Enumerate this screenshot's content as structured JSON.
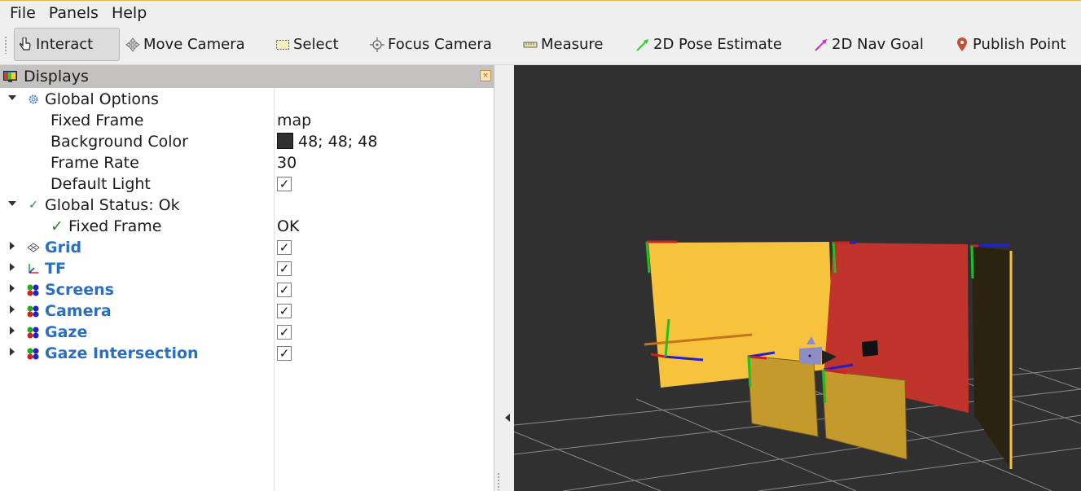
{
  "menu": {
    "file": "File",
    "panels": "Panels",
    "help": "Help"
  },
  "toolbar": {
    "tools": [
      {
        "label": "Interact",
        "icon": "hand-pointer-icon"
      },
      {
        "label": "Move Camera",
        "icon": "move-camera-icon"
      },
      {
        "label": "Select",
        "icon": "select-rect-icon"
      },
      {
        "label": "Focus Camera",
        "icon": "focus-camera-icon"
      },
      {
        "label": "Measure",
        "icon": "ruler-icon"
      },
      {
        "label": "2D Pose Estimate",
        "icon": "green-arrow-icon"
      },
      {
        "label": "2D Nav Goal",
        "icon": "magenta-arrow-icon"
      },
      {
        "label": "Publish Point",
        "icon": "map-pin-icon"
      }
    ],
    "active": "Interact"
  },
  "displays": {
    "title": "Displays",
    "rows": [
      {
        "label": "Global Options",
        "value": ""
      },
      {
        "label": "Fixed Frame",
        "value": "map"
      },
      {
        "label": "Background Color",
        "value": "48; 48; 48"
      },
      {
        "label": "Frame Rate",
        "value": "30"
      },
      {
        "label": "Default Light",
        "value": ""
      },
      {
        "label": "Global Status: Ok",
        "value": ""
      },
      {
        "label": "Fixed Frame",
        "value": "OK"
      },
      {
        "label": "Grid",
        "value": ""
      },
      {
        "label": "TF",
        "value": ""
      },
      {
        "label": "Screens",
        "value": ""
      },
      {
        "label": "Camera",
        "value": ""
      },
      {
        "label": "Gaze",
        "value": ""
      },
      {
        "label": "Gaze Intersection",
        "value": ""
      }
    ]
  },
  "colors": {
    "background": "#303030",
    "accent_blue": "#2a6fc0",
    "status_ok": "#2a8a2a",
    "screen_yellow": "#f7c33c",
    "screen_red": "#c0342c",
    "screen_dark": "#2a2310",
    "panel_gold": "#c49a2c"
  }
}
